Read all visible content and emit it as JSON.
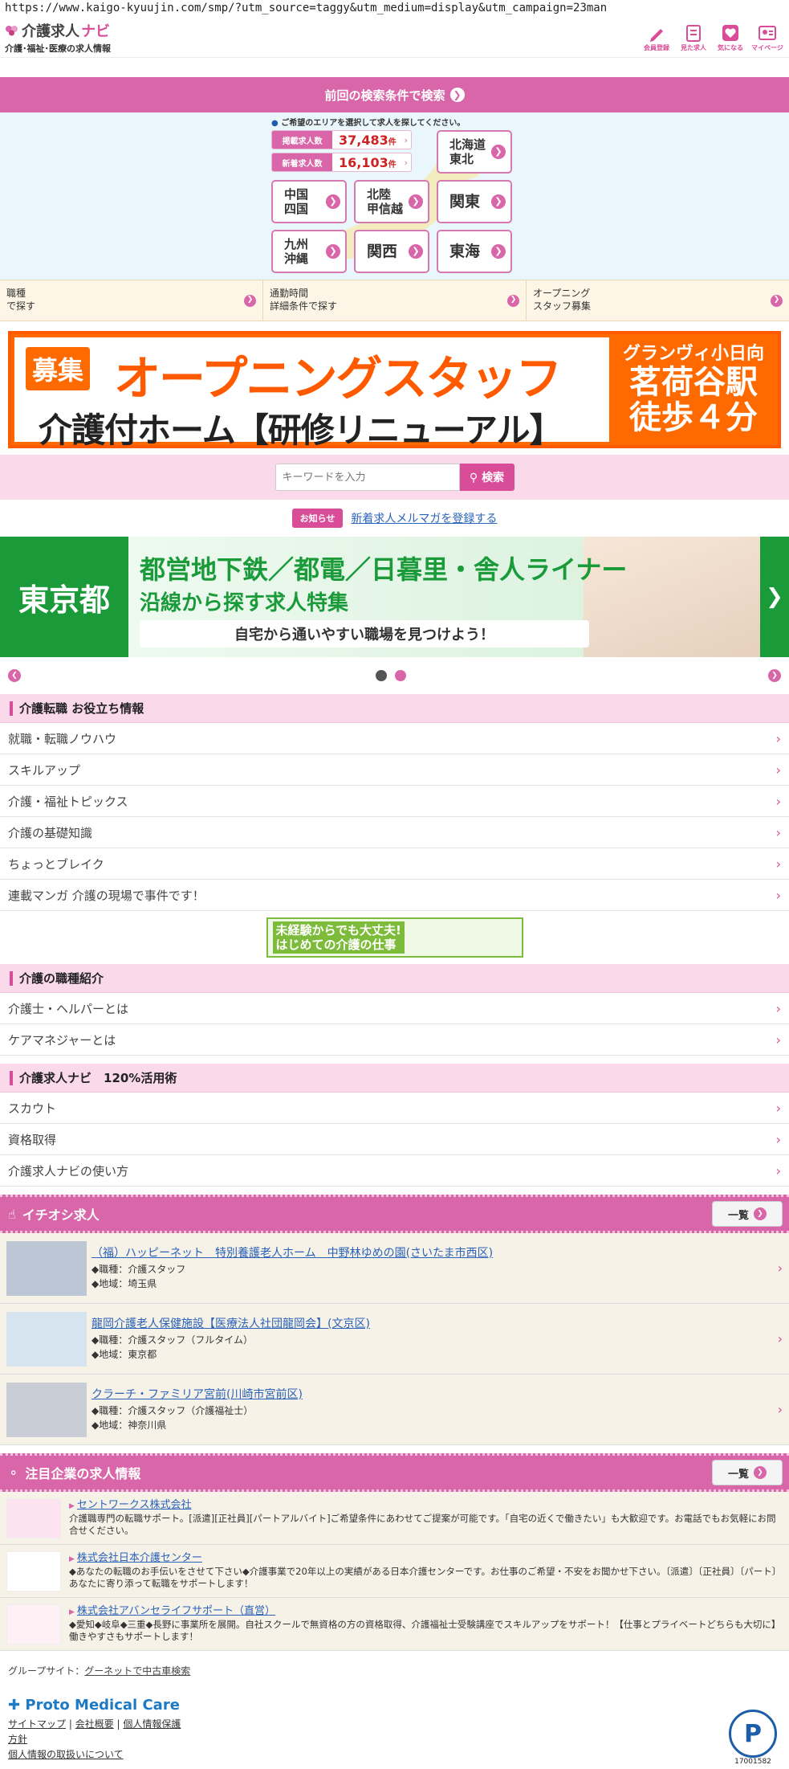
{
  "browser": {
    "url": "https://www.kaigo-kyuujin.com/smp/?utm_source=taggy&utm_medium=display&utm_campaign=23man"
  },
  "header": {
    "logo_main": "介護求人",
    "logo_navi": "ナビ",
    "logo_sub": "介護･福祉･医療の求人情報",
    "nav": [
      {
        "label": "会員登録",
        "icon": "pencil-icon"
      },
      {
        "label": "見た求人",
        "icon": "history-icon"
      },
      {
        "label": "気になる",
        "icon": "heart-icon"
      },
      {
        "label": "マイページ",
        "icon": "mypage-icon"
      }
    ]
  },
  "prev_search": {
    "label": "前回の検索条件で検索"
  },
  "area": {
    "message": "ご希望のエリアを選択して求人を探してください。",
    "total_label": "掲載求人数",
    "total_value": "37,483",
    "new_label": "新着求人数",
    "new_value": "16,103",
    "unit": "件",
    "regions": [
      "北海道\n東北",
      "中国\n四国",
      "北陸\n甲信越",
      "関東",
      "九州\n沖縄",
      "関西",
      "東海"
    ]
  },
  "search_links": [
    {
      "l1": "職種",
      "l2": "で探す"
    },
    {
      "l1": "通勤時間",
      "l2": "詳細条件で探す"
    },
    {
      "l1": "オープニング",
      "l2": "スタッフ募集"
    }
  ],
  "banner1": {
    "badge": "募集",
    "title": "オープニングスタッフ",
    "subtitle": "介護付ホーム【研修リニューアル】",
    "right_top": "グランヴィ小日向",
    "right_l1": "茗荷谷駅",
    "right_l2": "徒歩４分"
  },
  "keyword": {
    "placeholder": "キーワードを入力",
    "button": "検索"
  },
  "notice": {
    "badge": "お知らせ",
    "link": "新着求人メルマガを登録する"
  },
  "banner2": {
    "left": "東京都",
    "line1": "都営地下鉄／都電／日暮里・舎人ライナー",
    "line2": "沿線から探す求人特集",
    "line3": "自宅から通いやすい職場を見つけよう！"
  },
  "colors": {
    "accent": "#d966a8",
    "link": "#2a62b8",
    "dot_active": "#d966a8",
    "dot_inactive": "#555555"
  },
  "tips": {
    "title": "介護転職 お役立ち情報",
    "items": [
      "就職・転職ノウハウ",
      "スキルアップ",
      "介護・福祉トピックス",
      "介護の基礎知識",
      "ちょっとブレイク",
      "連載マンガ 介護の現場で事件です！"
    ]
  },
  "mid_banner": {
    "line1": "未経験からでも大丈夫!",
    "line2": "はじめての介護の仕事"
  },
  "jobtypes": {
    "title": "介護の職種紹介",
    "items": [
      "介護士・ヘルパーとは",
      "ケアマネジャーとは"
    ]
  },
  "usage": {
    "title": "介護求人ナビ　120%活用術",
    "items": [
      "スカウト",
      "資格取得",
      "介護求人ナビの使い方"
    ]
  },
  "featured": {
    "title": "イチオシ求人",
    "more": "一覧",
    "jobs": [
      {
        "title": "（福）ハッピーネット　特別養護老人ホーム　中野林ゆめの園(さいたま市西区)",
        "job": "◆職種：介護スタッフ",
        "area": "◆地域：埼玉県"
      },
      {
        "title": "龍岡介護老人保健施設【医療法人社団龍岡会】(文京区)",
        "job": "◆職種：介護スタッフ（フルタイム）",
        "area": "◆地域：東京都"
      },
      {
        "title": "クラーチ・ファミリア宮前(川崎市宮前区)",
        "job": "◆職種：介護スタッフ（介護福祉士）",
        "area": "◆地域：神奈川県"
      }
    ]
  },
  "companies": {
    "title": "注目企業の求人情報",
    "more": "一覧",
    "items": [
      {
        "name": "セントワークス株式会社",
        "desc": "介護職専門の転職サポート。[派遣][正社員][パートアルバイト]ご希望条件にあわせてご提案が可能です。「自宅の近くで働きたい」も大歓迎です。お電話でもお気軽にお問合せください。"
      },
      {
        "name": "株式会社日本介護センター",
        "desc": "◆あなたの転職のお手伝いをさせて下さい◆介護事業で20年以上の実績がある日本介護センターです。お仕事のご希望・不安をお聞かせ下さい。〔派遣〕〔正社員〕〔パート〕あなたに寄り添って転職をサポートします！"
      },
      {
        "name": "株式会社アバンセライフサポート（直営）",
        "desc": "◆愛知◆岐阜◆三重◆長野に事業所を展開。自社スクールで無資格の方の資格取得、介護福祉士受験講座でスキルアップをサポート！【仕事とプライベートどちらも大切に】働きやすさもサポートします！"
      }
    ]
  },
  "footer": {
    "group_label": "グループサイト：",
    "group_link": "グーネットで中古車検索",
    "brand": "Proto Medical Care",
    "links": [
      "サイトマップ",
      "会社概要",
      "個人情報保護",
      "方針",
      "個人情報の取扱いについて"
    ],
    "pmark_num": "17001582"
  }
}
